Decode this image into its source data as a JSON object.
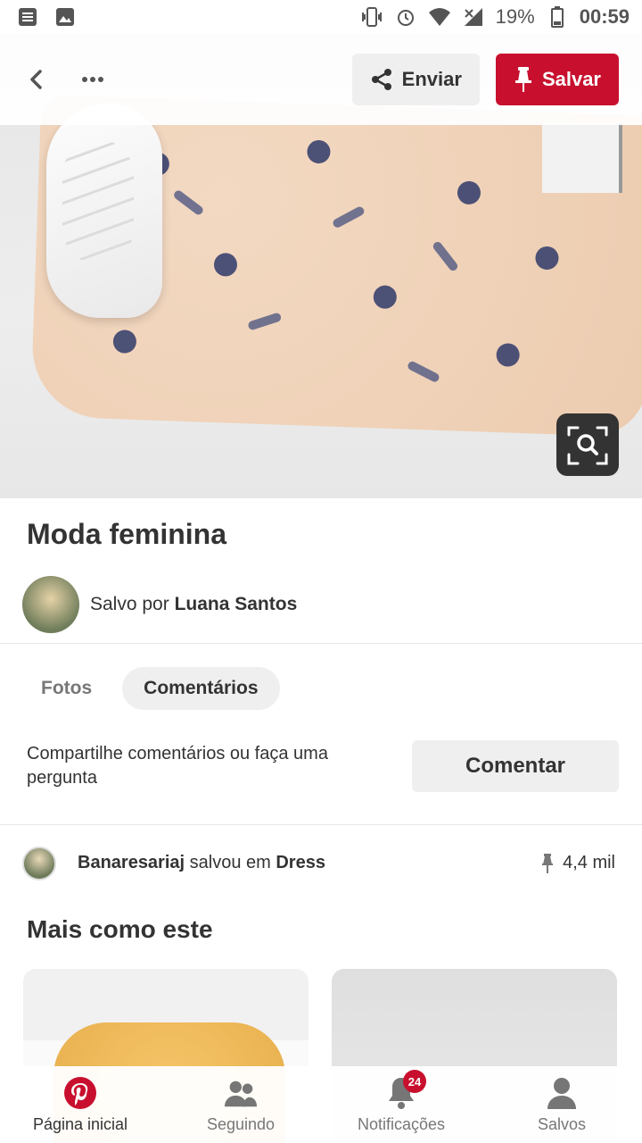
{
  "status_bar": {
    "battery_percent": "19%",
    "time": "00:59",
    "icons": [
      "notes-icon",
      "image-icon",
      "vibrate-icon",
      "alarm-icon",
      "wifi-icon",
      "signal-icon",
      "battery-icon"
    ]
  },
  "top_actions": {
    "send_label": "Enviar",
    "save_label": "Salvar"
  },
  "pin": {
    "title": "Moda feminina",
    "saved_by_prefix": "Salvo por",
    "saved_by_user": "Luana Santos"
  },
  "tabs": [
    {
      "label": "Fotos",
      "active": false
    },
    {
      "label": "Comentários",
      "active": true
    }
  ],
  "comments": {
    "prompt": "Compartilhe comentários ou faça uma pergunta",
    "button_label": "Comentar"
  },
  "activity": {
    "user": "Banaresariaj",
    "action": "salvou em",
    "board": "Dress",
    "count": "4,4 mil"
  },
  "more_section": {
    "title": "Mais como este"
  },
  "bottom_nav": [
    {
      "label": "Página inicial",
      "icon": "pinterest-logo-icon",
      "active": true
    },
    {
      "label": "Seguindo",
      "icon": "people-icon",
      "active": false
    },
    {
      "label": "Notificações",
      "icon": "bell-icon",
      "active": false,
      "badge": "24"
    },
    {
      "label": "Salvos",
      "icon": "profile-icon",
      "active": false
    }
  ],
  "colors": {
    "brand": "#c8102e",
    "button_gray": "#efefef",
    "text": "#333333"
  }
}
